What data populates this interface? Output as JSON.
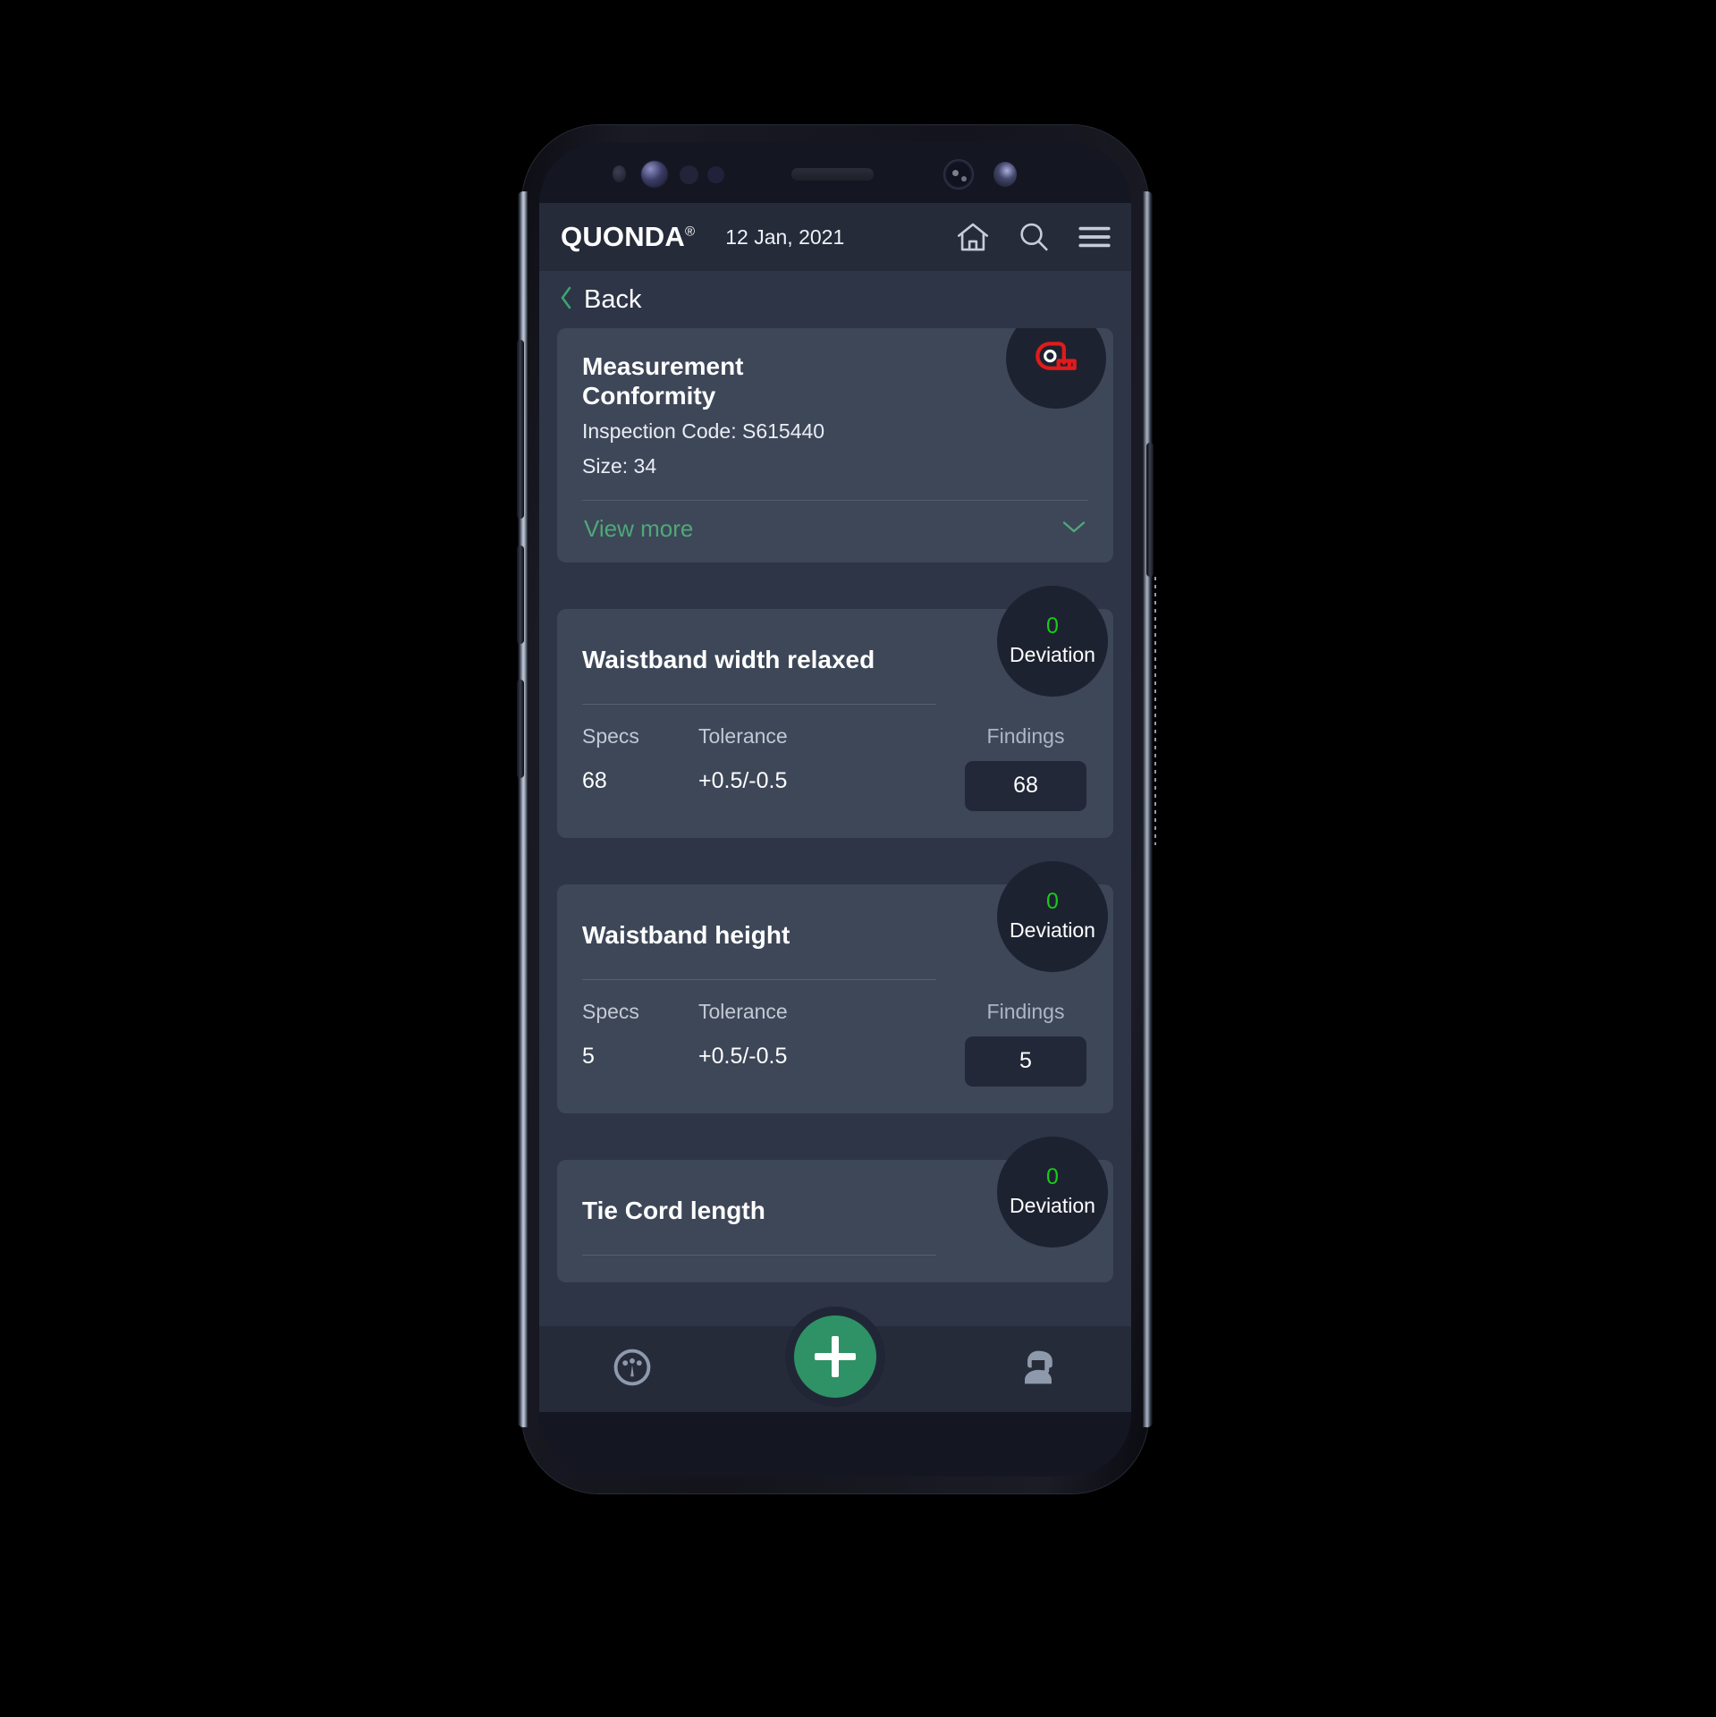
{
  "app": {
    "brand": "QUONDA",
    "brand_mark": "®",
    "date": "12 Jan, 2021",
    "icons": {
      "home": "home-icon",
      "search": "search-icon",
      "menu": "hamburger-menu-icon"
    }
  },
  "back": {
    "label": "Back",
    "icon": "chevron-left-icon"
  },
  "info_card": {
    "title_line1": "Measurement",
    "title_line2": "Conformity",
    "inspection_code": "Inspection Code: S615440",
    "size": "Size: 34",
    "view_more": "View more",
    "view_more_icon": "chevron-down-icon",
    "badge_icon": "tape-measure-icon"
  },
  "labels": {
    "specs": "Specs",
    "tolerance": "Tolerance",
    "findings": "Findings",
    "deviation": "Deviation"
  },
  "measurements": [
    {
      "name": "Waistband width relaxed",
      "specs": "68",
      "tolerance": "+0.5/-0.5",
      "findings": "68",
      "deviation": "0"
    },
    {
      "name": "Waistband height",
      "specs": "5",
      "tolerance": "+0.5/-0.5",
      "findings": "5",
      "deviation": "0"
    },
    {
      "name": "Tie Cord length",
      "specs": "",
      "tolerance": "",
      "findings": "",
      "deviation": "0"
    }
  ],
  "bottom_nav": {
    "left_icon": "dashboard-gauge-icon",
    "add_icon": "plus-icon",
    "right_icon": "support-agent-icon"
  },
  "colors": {
    "accent_green": "#2e9266",
    "link_green": "#4fa878",
    "deviation_green": "#17cc17",
    "card_bg": "#3d4758",
    "screen_bg": "#2d3546",
    "appbar_bg": "#262b3a",
    "tape_red": "#e01b1b"
  }
}
